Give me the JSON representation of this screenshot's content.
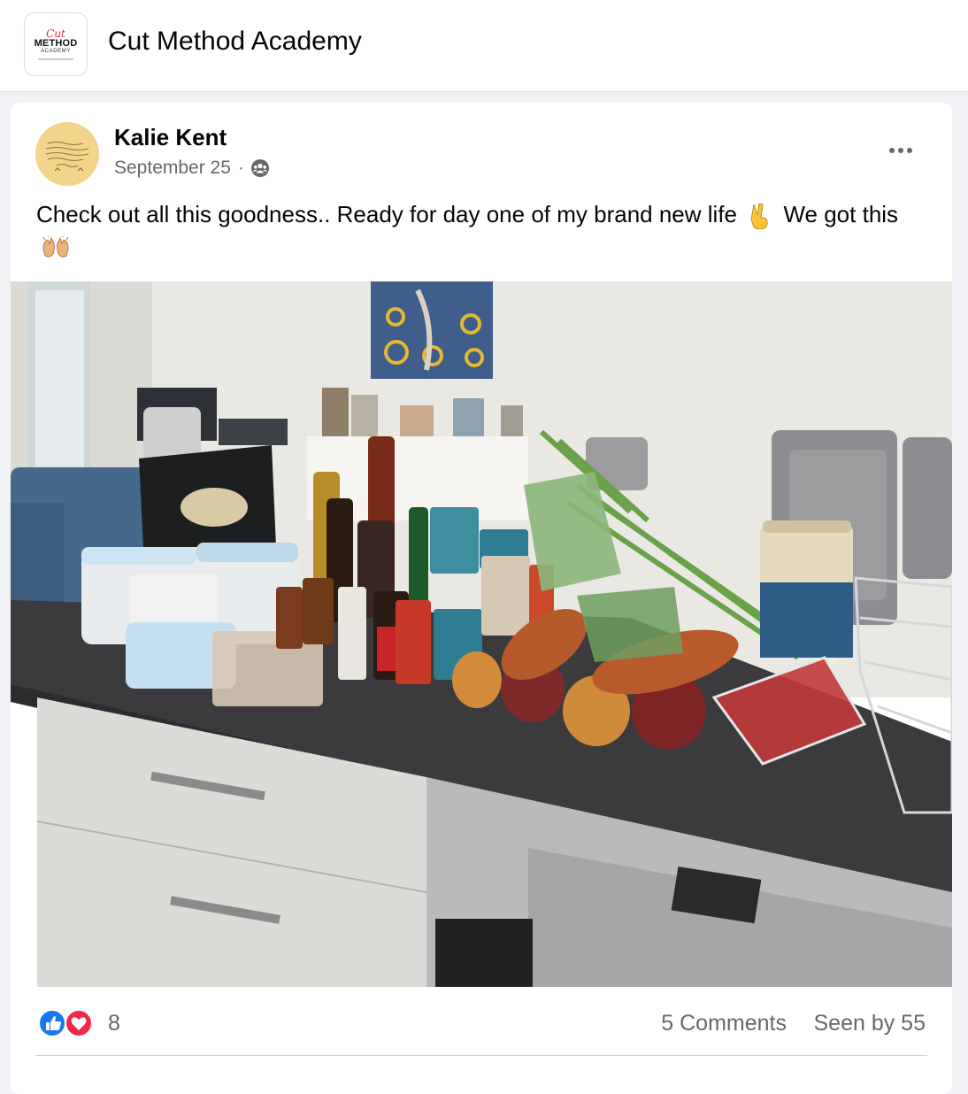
{
  "group": {
    "name": "Cut Method Academy",
    "logo": {
      "line1": "Cut",
      "line2": "METHOD",
      "line3": "ACADEMY"
    }
  },
  "post": {
    "author": "Kalie Kent",
    "date": "September 25",
    "separator": "·",
    "privacy_icon": "group-members-icon",
    "text_part1": "Check out all this goodness.. Ready for day one of my brand new life",
    "emoji1": "victory-hand-emoji",
    "text_part2": "We got this",
    "emoji2": "raising-hands-emoji",
    "photo_alt": "Groceries on a kitchen bench",
    "reactions": {
      "icons": [
        "like-icon",
        "love-icon"
      ],
      "count": "8"
    },
    "comments_label": "5 Comments",
    "seen_label": "Seen by 55"
  },
  "colors": {
    "like_blue": "#1877f2",
    "love_red": "#f02849",
    "meta_gray": "#65676b"
  }
}
